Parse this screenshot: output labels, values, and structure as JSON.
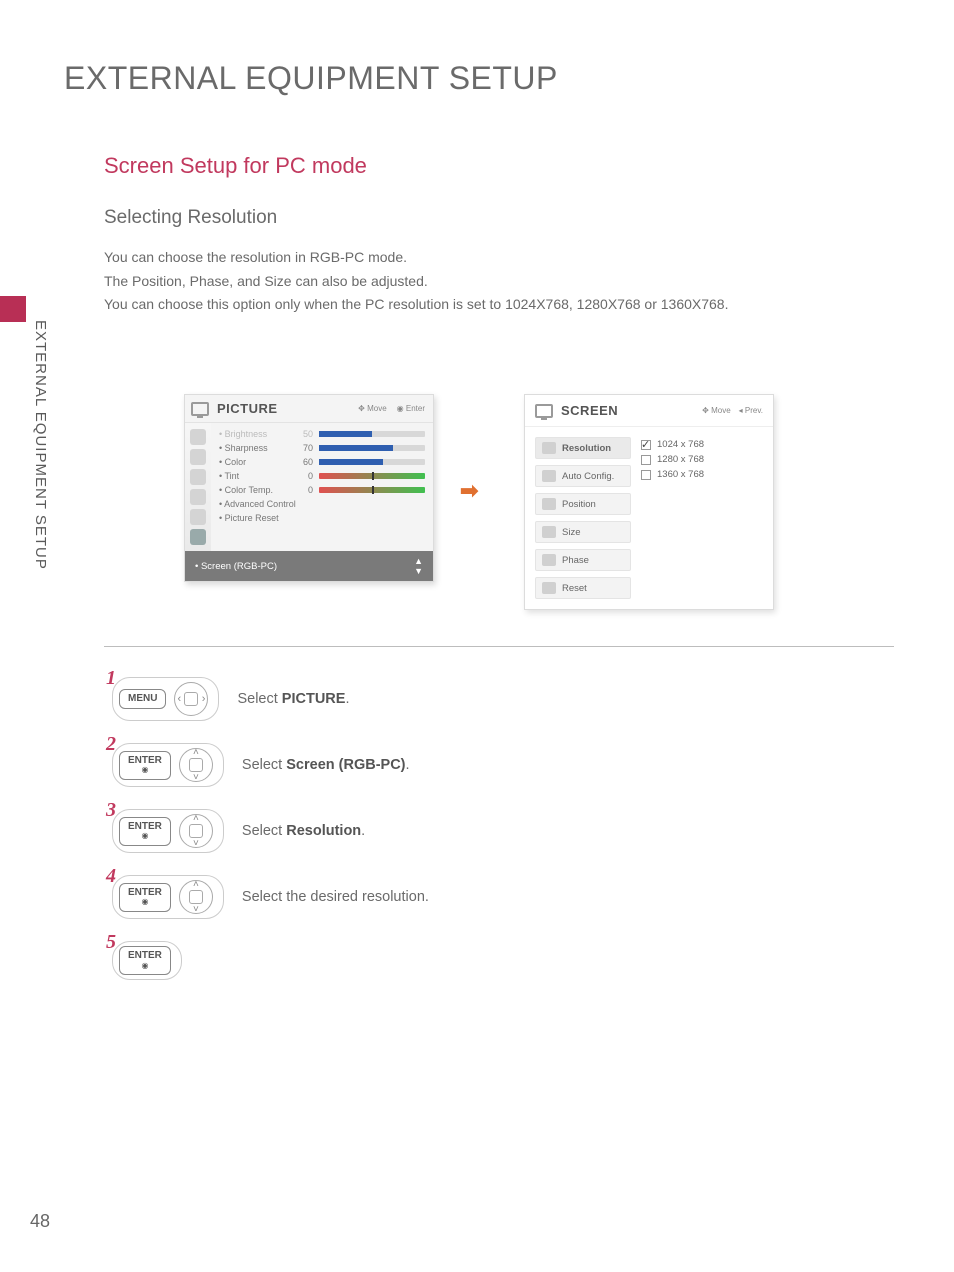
{
  "side_label": "EXTERNAL EQUIPMENT SETUP",
  "page_number": "48",
  "heading": "EXTERNAL EQUIPMENT SETUP",
  "subheading": "Screen Setup for PC mode",
  "subsubheading": "Selecting Resolution",
  "description": {
    "l1": "You can choose the resolution in RGB-PC mode.",
    "l2": "The Position, Phase, and Size can also be adjusted.",
    "l3": "You can choose this option only when the PC resolution is set to 1024X768, 1280X768 or 1360X768."
  },
  "picture_menu": {
    "title": "PICTURE",
    "move_hint": "Move",
    "enter_hint": "Enter",
    "rows": {
      "brightness": {
        "label": "• Brightness",
        "value": "50",
        "fill": 50
      },
      "sharpness": {
        "label": "• Sharpness",
        "value": "70",
        "fill": 70
      },
      "color": {
        "label": "• Color",
        "value": "60",
        "fill": 60
      },
      "tint": {
        "label": "• Tint",
        "value": "0",
        "cursor": 50
      },
      "colortemp": {
        "label": "• Color Temp.",
        "value": "0",
        "cursor": 50
      },
      "advanced": {
        "label": "• Advanced Control"
      },
      "reset": {
        "label": "• Picture Reset"
      }
    },
    "footer": "• Screen (RGB-PC)"
  },
  "screen_menu": {
    "title": "SCREEN",
    "move_hint": "Move",
    "prev_hint": "Prev.",
    "items": {
      "resolution": "Resolution",
      "autoconfig": "Auto Config.",
      "position": "Position",
      "size": "Size",
      "phase": "Phase",
      "reset": "Reset"
    },
    "options": {
      "o1": "1024 x 768",
      "o2": "1280 x 768",
      "o3": "1360 x 768"
    }
  },
  "steps": {
    "menu_btn": "MENU",
    "enter_btn": "ENTER",
    "s1_pre": "Select ",
    "s1_bold": "PICTURE",
    "s1_post": ".",
    "s2_pre": "Select ",
    "s2_bold": "Screen (RGB-PC)",
    "s2_post": ".",
    "s3_pre": "Select ",
    "s3_bold": "Resolution",
    "s3_post": ".",
    "s4": "Select the desired resolution."
  },
  "nums": {
    "n1": "1",
    "n2": "2",
    "n3": "3",
    "n4": "4",
    "n5": "5"
  }
}
